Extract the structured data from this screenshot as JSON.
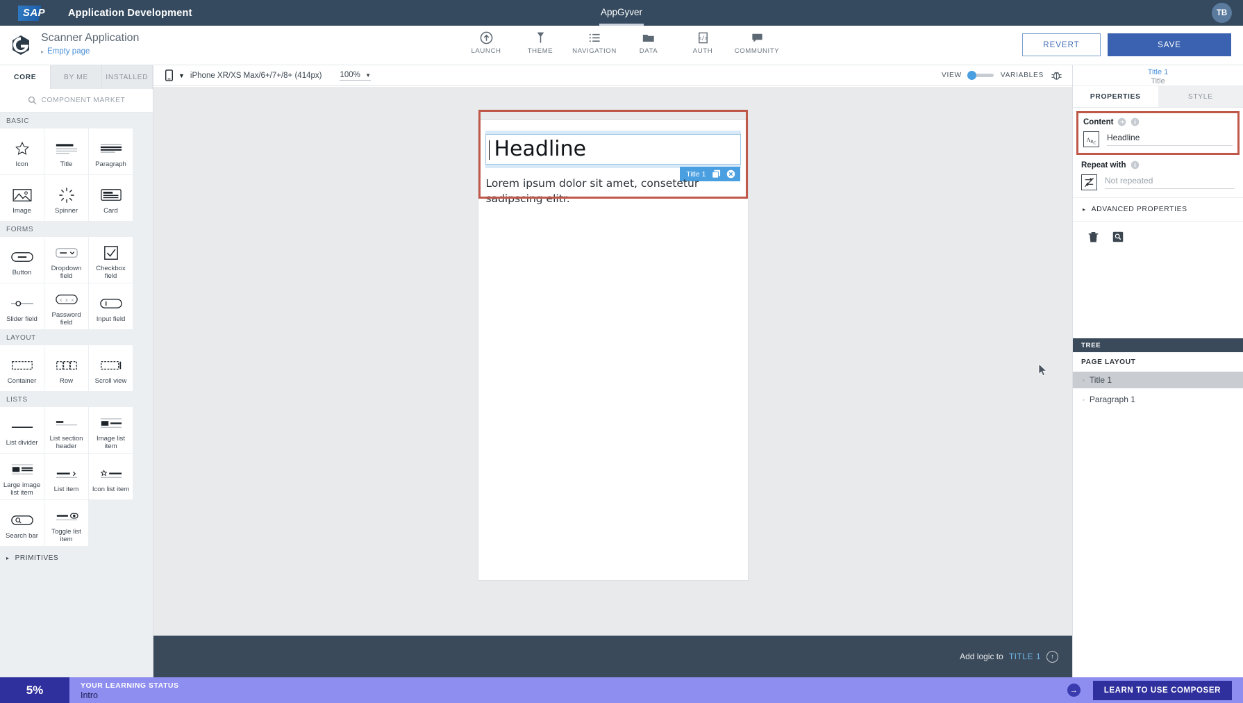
{
  "topbar": {
    "logo": "SAP",
    "title": "Application Development",
    "center_label": "AppGyver",
    "avatar_initials": "TB"
  },
  "header": {
    "app_name": "Scanner Application",
    "breadcrumb": "Empty page",
    "nav_tools": [
      {
        "label": "LAUNCH",
        "icon": "launch-icon"
      },
      {
        "label": "THEME",
        "icon": "theme-icon"
      },
      {
        "label": "NAVIGATION",
        "icon": "navigation-icon"
      },
      {
        "label": "DATA",
        "icon": "data-icon"
      },
      {
        "label": "AUTH",
        "icon": "auth-icon"
      },
      {
        "label": "COMMUNITY",
        "icon": "community-icon"
      }
    ],
    "revert_label": "REVERT",
    "save_label": "SAVE"
  },
  "left_panel": {
    "tabs": [
      {
        "label": "CORE",
        "active": true
      },
      {
        "label": "BY ME",
        "active": false
      },
      {
        "label": "INSTALLED",
        "active": false
      }
    ],
    "search_label": "COMPONENT MARKET",
    "sections": [
      {
        "title": "BASIC",
        "items": [
          {
            "label": "Icon",
            "icon": "star-icon"
          },
          {
            "label": "Title",
            "icon": "title-icon"
          },
          {
            "label": "Paragraph",
            "icon": "paragraph-icon"
          },
          {
            "label": "Image",
            "icon": "image-icon"
          },
          {
            "label": "Spinner",
            "icon": "spinner-icon"
          },
          {
            "label": "Card",
            "icon": "card-icon"
          }
        ]
      },
      {
        "title": "FORMS",
        "items": [
          {
            "label": "Button",
            "icon": "button-icon"
          },
          {
            "label": "Dropdown field",
            "icon": "dropdown-icon"
          },
          {
            "label": "Checkbox field",
            "icon": "checkbox-icon"
          },
          {
            "label": "Slider field",
            "icon": "slider-icon"
          },
          {
            "label": "Password field",
            "icon": "password-icon"
          },
          {
            "label": "Input field",
            "icon": "input-icon"
          }
        ]
      },
      {
        "title": "LAYOUT",
        "items": [
          {
            "label": "Container",
            "icon": "container-icon"
          },
          {
            "label": "Row",
            "icon": "row-icon"
          },
          {
            "label": "Scroll view",
            "icon": "scrollview-icon"
          }
        ]
      },
      {
        "title": "LISTS",
        "items": [
          {
            "label": "List divider",
            "icon": "list-divider-icon"
          },
          {
            "label": "List section header",
            "icon": "list-section-header-icon"
          },
          {
            "label": "Image list item",
            "icon": "image-list-item-icon"
          },
          {
            "label": "Large image list item",
            "icon": "large-image-list-item-icon"
          },
          {
            "label": "List item",
            "icon": "list-item-icon"
          },
          {
            "label": "Icon list item",
            "icon": "icon-list-item-icon"
          },
          {
            "label": "Search bar",
            "icon": "search-bar-icon"
          },
          {
            "label": "Toggle list item",
            "icon": "toggle-list-item-icon"
          }
        ]
      }
    ],
    "primitives_label": "PRIMITIVES"
  },
  "canvas": {
    "device": "iPhone XR/XS Max/6+/7+/8+ (414px)",
    "zoom": "100%",
    "view_label": "VIEW",
    "variables_label": "VARIABLES",
    "debug_icon": "bug-icon",
    "component": {
      "headline": "Headline",
      "paragraph": "Lorem ipsum dolor sit amet, consetetur sadipscing elitr.",
      "badge_label": "Title 1"
    }
  },
  "right_panel": {
    "component_name": "Title 1",
    "component_type": "Title",
    "tabs": [
      {
        "label": "PROPERTIES",
        "active": true
      },
      {
        "label": "STYLE",
        "active": false
      }
    ],
    "content": {
      "label": "Content",
      "icon": "abc-icon",
      "value": "Headline"
    },
    "repeat": {
      "label": "Repeat with",
      "icon": "repeat-icon",
      "value": "Not repeated"
    },
    "advanced_label": "ADVANCED PROPERTIES",
    "actions": [
      {
        "icon": "trash-icon"
      },
      {
        "icon": "inspect-icon"
      }
    ],
    "tree": {
      "header": "TREE",
      "subheader": "PAGE LAYOUT",
      "items": [
        {
          "label": "Title 1",
          "selected": true
        },
        {
          "label": "Paragraph 1",
          "selected": false
        }
      ]
    }
  },
  "logic_bar": {
    "prefix": "Add logic to",
    "target": "TITLE 1"
  },
  "learning_bar": {
    "percent": "5%",
    "title": "YOUR LEARNING STATUS",
    "subtitle": "Intro",
    "cta": "LEARN TO USE COMPOSER"
  },
  "colors": {
    "brand_dark": "#354a5f",
    "accent_blue": "#3a62b0",
    "selection_red": "#c0584a",
    "selection_blue": "#4a9fe0",
    "learn_purple": "#8e8df0",
    "learn_dark": "#2f2f9e"
  }
}
